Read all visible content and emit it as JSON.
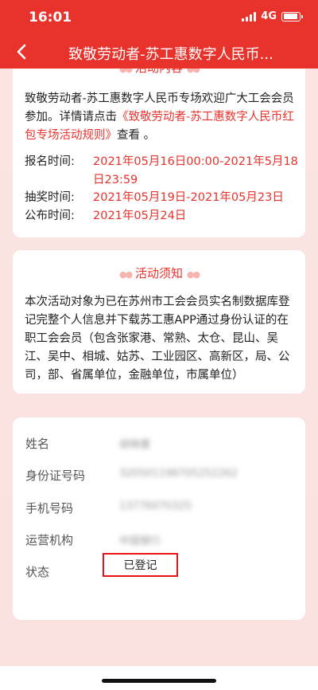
{
  "status_bar": {
    "time": "16:01",
    "network": "4G"
  },
  "nav": {
    "title": "致敬劳动者-苏工惠数字人民币..."
  },
  "activity_content": {
    "title": "活动内容",
    "intro_prefix": "致敬劳动者-苏工惠数字人民币专场欢迎广大工会会员参加。详情请点击",
    "rules_link": "《致敬劳动者-苏工惠数字人民币红包专场活动规则》",
    "intro_suffix": "查看 。",
    "signup_label": "报名时间:",
    "signup_value": "2021年05月16日00:00-2021年5月18日23:59",
    "lottery_label": "抽奖时间:",
    "lottery_value": "2021年05月19日-2021年05月23日",
    "announce_label": "公布时间:",
    "announce_value": "2021年05月24日"
  },
  "activity_notice": {
    "title": "活动须知",
    "text": "本次活动对象为已在苏州市工会会员实名制数据库登记完整个人信息并下载苏工惠APP通过身份认证的在职工会会员（包含张家港、常熟、太仓、昆山、吴江、吴中、相城、姑苏、工业园区、高新区，局、公司，部、省属单位，金融单位，市属单位）"
  },
  "user_info": {
    "name_label": "姓名",
    "name_value": "胡晓蕾",
    "id_label": "身份证号码",
    "id_value": "320501198705252262",
    "phone_label": "手机号码",
    "phone_value": "13776070325",
    "org_label": "运营机构",
    "org_value": "中国银行",
    "status_label": "状态",
    "status_value": "已登记"
  },
  "colors": {
    "brand_red": "#e8322c",
    "background_pink": "#fbe1df"
  }
}
